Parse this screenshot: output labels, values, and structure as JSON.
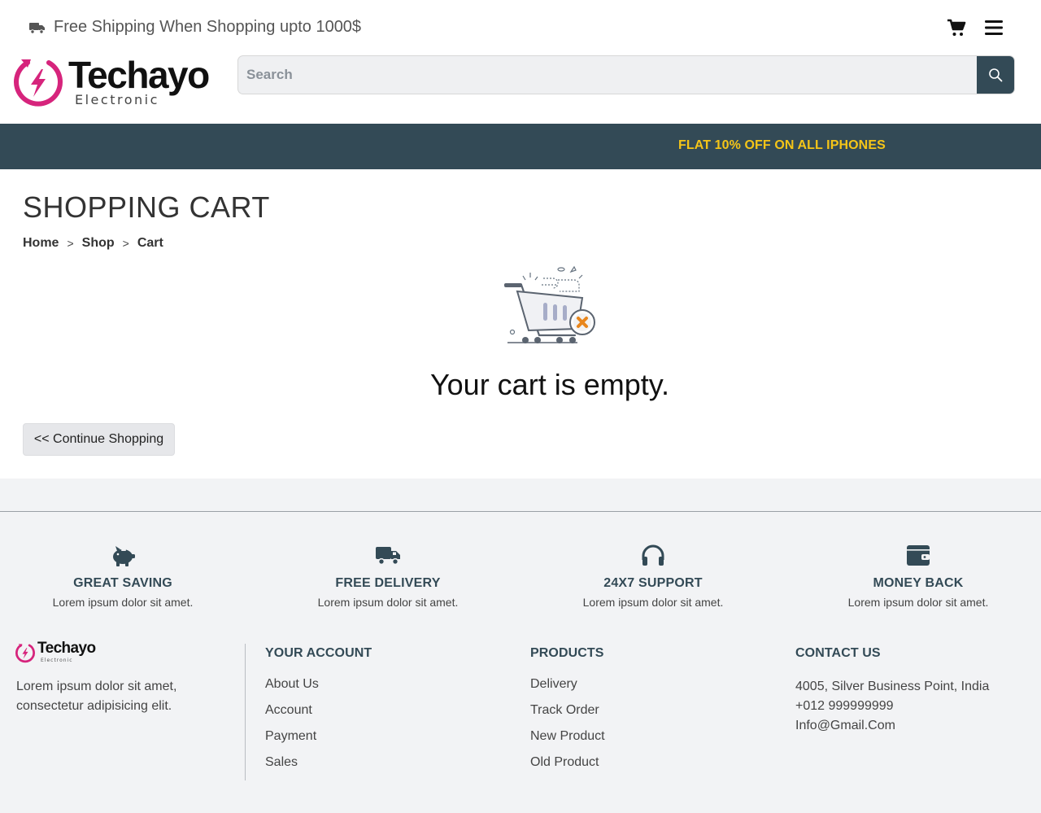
{
  "topbar": {
    "shipping_text": "Free Shipping When Shopping upto 1000$",
    "icons": [
      "truck-icon",
      "cart-icon",
      "hamburger-menu-icon"
    ]
  },
  "brand": {
    "name": "Techayo",
    "tagline": "Electronic",
    "colors": {
      "accent_pink": "#d6247c",
      "dark": "#111111"
    }
  },
  "search": {
    "placeholder": "Search",
    "value": ""
  },
  "promo": {
    "text": "FLAT 10% OFF ON ALL IPHONES",
    "background": "#334a56",
    "text_color": "#f5c518"
  },
  "main": {
    "title": "SHOPPING CART",
    "breadcrumb": [
      {
        "label": "Home"
      },
      {
        "label": "Shop"
      },
      {
        "label": "Cart"
      }
    ],
    "breadcrumb_sep": ">",
    "empty_message": "Your cart is empty.",
    "continue_label": "<< Continue Shopping"
  },
  "features": [
    {
      "icon": "piggy-bank-icon",
      "title": "GREAT SAVING",
      "text": "Lorem ipsum dolor sit amet."
    },
    {
      "icon": "truck-icon",
      "title": "FREE DELIVERY",
      "text": "Lorem ipsum dolor sit amet."
    },
    {
      "icon": "headphones-icon",
      "title": "24X7 SUPPORT",
      "text": "Lorem ipsum dolor sit amet."
    },
    {
      "icon": "wallet-icon",
      "title": "MONEY BACK",
      "text": "Lorem ipsum dolor sit amet."
    }
  ],
  "footer": {
    "about": "Lorem ipsum dolor sit amet, consectetur adipisicing elit.",
    "account": {
      "heading": "YOUR ACCOUNT",
      "links": [
        "About Us",
        "Account",
        "Payment",
        "Sales"
      ]
    },
    "products": {
      "heading": "PRODUCTS",
      "links": [
        "Delivery",
        "Track Order",
        "New Product",
        "Old Product"
      ]
    },
    "contact": {
      "heading": "CONTACT US",
      "address": "4005, Silver Business Point, India",
      "phone": "+012 999999999",
      "email": "Info@Gmail.Com"
    }
  }
}
